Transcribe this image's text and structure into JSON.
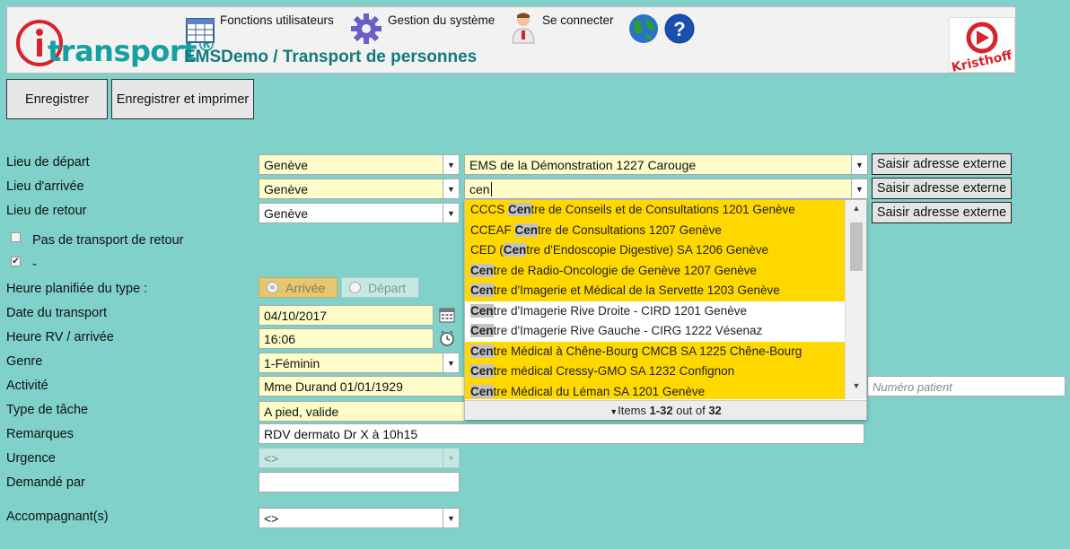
{
  "header": {
    "logo_text": "transport",
    "logo_reg": "®",
    "app_title": "EMSDemo / Transport de personnes",
    "menu": [
      {
        "label": "Fonctions utilisateurs",
        "icon": "table-icon"
      },
      {
        "label": "Gestion du système",
        "icon": "gear-icon"
      },
      {
        "label": "Se connecter",
        "icon": "user-doctor-icon"
      }
    ],
    "globe_icon": "globe-icon",
    "help_icon": "help-icon",
    "brand": "Kristhoff"
  },
  "toolbar": {
    "save_label": "Enregistrer",
    "save_print_label": "Enregistrer et imprimer"
  },
  "form": {
    "depart": {
      "label": "Lieu de départ",
      "city": "Genève",
      "address": "EMS de la Démonstration 1227 Carouge",
      "ext_btn": "Saisir adresse externe"
    },
    "arrivee": {
      "label": "Lieu d'arrivée",
      "city": "Genève",
      "address": "cen",
      "ext_btn": "Saisir adresse externe"
    },
    "retour": {
      "label": "Lieu de retour",
      "city": "Genève",
      "ext_btn": "Saisir adresse externe"
    },
    "no_return": {
      "label": "Pas de transport de retour",
      "checked": false
    },
    "dash": {
      "label": "-",
      "checked": true
    },
    "heure_type": {
      "label": "Heure planifiée du type :",
      "opt_arrivee": "Arrivée",
      "opt_depart": "Départ"
    },
    "date": {
      "label": "Date du transport",
      "value": "04/10/2017"
    },
    "heure": {
      "label": "Heure RV / arrivée",
      "value": "16:06"
    },
    "genre": {
      "label": "Genre",
      "value": "1-Féminin"
    },
    "activite": {
      "label": "Activité",
      "value": "Mme Durand 01/01/1929",
      "patient_placeholder": "Numéro patient"
    },
    "tache": {
      "label": "Type de tâche",
      "value": "A pied, valide"
    },
    "remarques": {
      "label": "Remarques",
      "value": "RDV dermato Dr X à 10h15"
    },
    "urgence": {
      "label": "Urgence",
      "value": "<>"
    },
    "demande": {
      "label": "Demandé par",
      "value": ""
    },
    "accompagnant": {
      "label": "Accompagnant(s)",
      "value": "<>"
    }
  },
  "dropdown": {
    "items": [
      {
        "pre": "CCCS ",
        "hl": "Cen",
        "post": "tre de Conseils et de Consultations 1201 Genève",
        "yellow": true
      },
      {
        "pre": "CCEAF ",
        "hl": "Cen",
        "post": "tre de Consultations 1207 Genève",
        "yellow": true
      },
      {
        "pre": "CED (",
        "hl": "Cen",
        "post": "tre d'Endoscopie Digestive) SA 1206 Genève",
        "yellow": true
      },
      {
        "pre": "",
        "hl": "Cen",
        "post": "tre de Radio-Oncologie de Genève 1207 Genève",
        "yellow": true
      },
      {
        "pre": "",
        "hl": "Cen",
        "post": "tre d'Imagerie et Médical de la Servette 1203 Genève",
        "yellow": true
      },
      {
        "pre": "",
        "hl": "Cen",
        "post": "tre d'Imagerie Rive Droite - CIRD 1201 Genève",
        "yellow": false
      },
      {
        "pre": "",
        "hl": "Cen",
        "post": "tre d'Imagerie Rive Gauche - CIRG 1222 Vésenaz",
        "yellow": false
      },
      {
        "pre": "",
        "hl": "Cen",
        "post": "tre Médical à Chêne-Bourg CMCB SA 1225 Chêne-Bourg",
        "yellow": true
      },
      {
        "pre": "",
        "hl": "Cen",
        "post": "tre médical Cressy-GMO SA 1232 Confignon",
        "yellow": true
      },
      {
        "pre": "",
        "hl": "Cen",
        "post": "tre Médical du Léman SA 1201 Genève",
        "yellow": true
      }
    ],
    "footer_prefix": "Items ",
    "footer_range": "1-32",
    "footer_mid": " out of ",
    "footer_total": "32"
  }
}
